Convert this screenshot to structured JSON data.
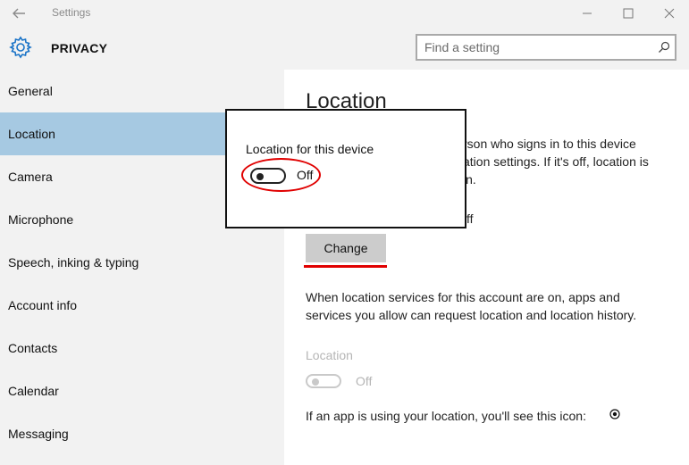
{
  "window": {
    "title": "Settings",
    "controls": [
      "minimize-icon",
      "maximize-icon",
      "close-icon"
    ]
  },
  "header": {
    "section_title": "PRIVACY",
    "icon": "gear-icon",
    "search": {
      "placeholder": "Find a setting",
      "value": ""
    }
  },
  "sidebar": {
    "active": "Location",
    "items": [
      {
        "label": "General"
      },
      {
        "label": "Location"
      },
      {
        "label": "Camera"
      },
      {
        "label": "Microphone"
      },
      {
        "label": "Speech, inking & typing"
      },
      {
        "label": "Account info"
      },
      {
        "label": "Contacts"
      },
      {
        "label": "Calendar"
      },
      {
        "label": "Messaging"
      }
    ]
  },
  "main": {
    "title": "Location",
    "visible_desc_lines": [
      "rson who signs in to this device",
      "ation settings. If it's off, location is",
      "in."
    ],
    "visible_status_fragment": "ff",
    "change_label": "Change",
    "account_desc_lines": [
      "When location services for this account are on, apps and",
      "services you allow can request location and location history."
    ],
    "location_label": "Location",
    "location_toggle_state": "Off",
    "icon_note": "If an app is using your location, you'll see this icon:"
  },
  "popup": {
    "label": "Location for this device",
    "toggle_state": "Off"
  },
  "colors": {
    "sidebar_bg": "#f2f2f2",
    "active_item_bg": "#a6c9e2",
    "annotation_red": "#e00000",
    "button_bg": "#cccccc",
    "gear_blue": "#1a73c7"
  }
}
